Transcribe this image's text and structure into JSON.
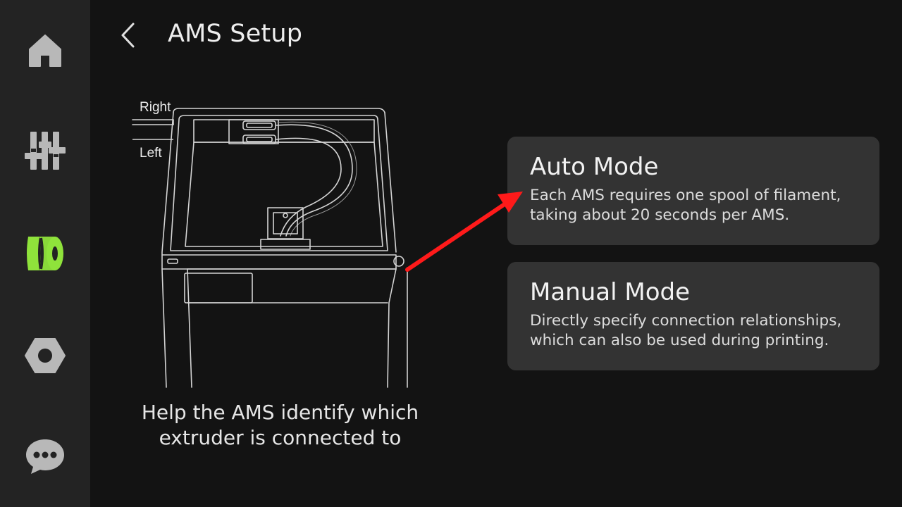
{
  "header": {
    "title": "AMS Setup"
  },
  "sidebar": {
    "items": [
      {
        "icon": "home-icon"
      },
      {
        "icon": "sliders-icon"
      },
      {
        "icon": "filament-spool-icon",
        "active": true
      },
      {
        "icon": "hex-nut-icon"
      },
      {
        "icon": "chat-icon"
      }
    ],
    "active_color": "#8fe33b",
    "inactive_color": "#b8b8b8"
  },
  "illustration": {
    "label_right": "Right",
    "label_left": "Left"
  },
  "help_text": {
    "line1": "Help the AMS identify which",
    "line2": "extruder is connected to"
  },
  "modes": {
    "auto": {
      "title": "Auto Mode",
      "desc_line1": "Each AMS requires one spool of filament,",
      "desc_line2": "taking about 20 seconds per AMS."
    },
    "manual": {
      "title": "Manual Mode",
      "desc_line1": "Directly specify connection relationships,",
      "desc_line2": "which can also be used during printing."
    }
  },
  "colors": {
    "background": "#131313",
    "sidebar": "#232323",
    "card": "#333333",
    "annotation_arrow": "#ff1a1a"
  }
}
